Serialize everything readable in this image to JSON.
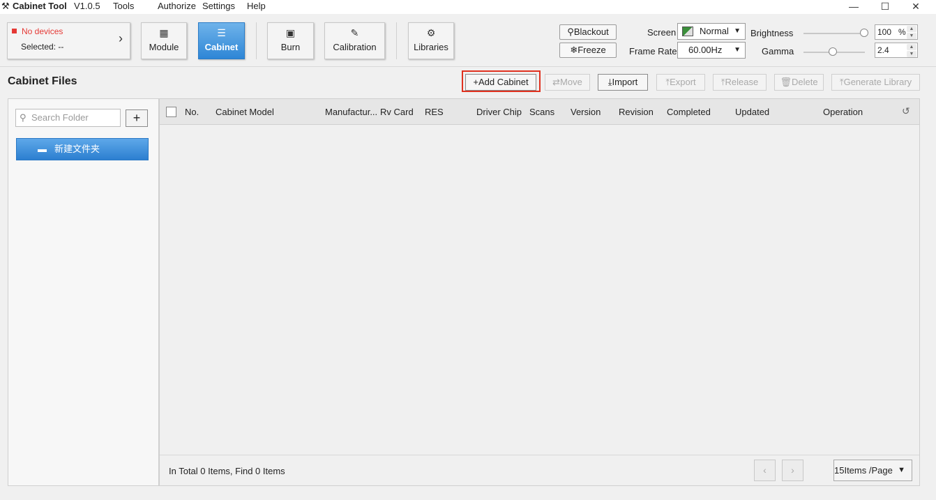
{
  "app": {
    "name": "Cabinet Tool",
    "version": "V1.0.5"
  },
  "menu": [
    "Tools",
    "Authorize",
    "Settings",
    "Help"
  ],
  "window_controls": {
    "minimize": "—",
    "maximize": "☐",
    "close": "✕"
  },
  "device": {
    "status": "No devices",
    "selected": "Selected: --"
  },
  "toolbar": {
    "module": "Module",
    "cabinet": "Cabinet",
    "burn": "Burn",
    "calibration": "Calibration",
    "libraries": "Libraries",
    "blackout": "Blackout",
    "freeze": "Freeze"
  },
  "display": {
    "screen_label": "Screen",
    "screen_value": "Normal",
    "frame_rate_label": "Frame Rate",
    "frame_rate_value": "60.00Hz",
    "brightness_label": "Brightness",
    "brightness_value": "100",
    "brightness_unit": "%",
    "brightness_level": 1.0,
    "gamma_label": "Gamma",
    "gamma_value": "2.4"
  },
  "section": {
    "title": "Cabinet Files"
  },
  "actions": {
    "add_cabinet": "Add Cabinet",
    "move": "Move",
    "import": "Import",
    "export": "Export",
    "release": "Release",
    "delete": "Delete",
    "generate_library": "Generate Library"
  },
  "folders": {
    "search_placeholder": "Search Folder",
    "items": [
      "新建文件夹"
    ]
  },
  "table": {
    "columns": [
      "No.",
      "Cabinet Model",
      "Manufactur...",
      "Rv Card",
      "RES",
      "Driver Chip",
      "Scans",
      "Version",
      "Revision",
      "Completed",
      "Updated",
      "Operation"
    ],
    "rows": [],
    "total_text": "In Total 0 Items, Find 0 Items",
    "page_size": "15Items /Page"
  },
  "colors": {
    "accent": "#2e86d6",
    "error": "#e53935",
    "highlight_box": "#e0311f"
  }
}
